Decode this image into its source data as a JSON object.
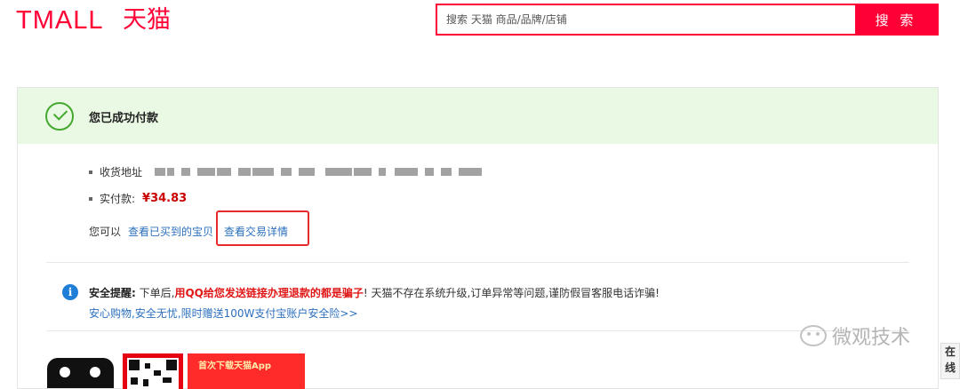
{
  "header": {
    "logo_text": "TMALL",
    "logo_cn": "天猫",
    "search_placeholder": "搜索 天猫 商品/品牌/店铺",
    "search_button": "搜 索"
  },
  "success": {
    "title": "您已成功付款"
  },
  "order": {
    "address_label": "收货地址",
    "paid_label": "实付款:",
    "paid_amount": "¥34.83",
    "you_can": "您可以",
    "view_bought_link": "查看已买到的宝贝",
    "view_detail_link": "查看交易详情"
  },
  "notice": {
    "title": "安全提醒:",
    "text_before": "下单后,",
    "text_red": "用QQ给您发送链接办理退款的都是骗子",
    "text_after": "! 天猫不存在系统升级,订单异常等问题,谨防假冒客服电话诈骗!",
    "sub_link": "安心购物,安全无忧,限时赠送100W支付宝账户安全险>>"
  },
  "promo": {
    "ribbon_text": "首次下载天猫App"
  },
  "watermark": {
    "text": "微观技术"
  },
  "side_tab": {
    "label": "在线"
  },
  "colors": {
    "brand_red": "#ff0036",
    "success_bg": "#e9f9e3",
    "success_green": "#45a82f",
    "link_blue": "#2c6fbd",
    "price_red": "#cc0000"
  }
}
